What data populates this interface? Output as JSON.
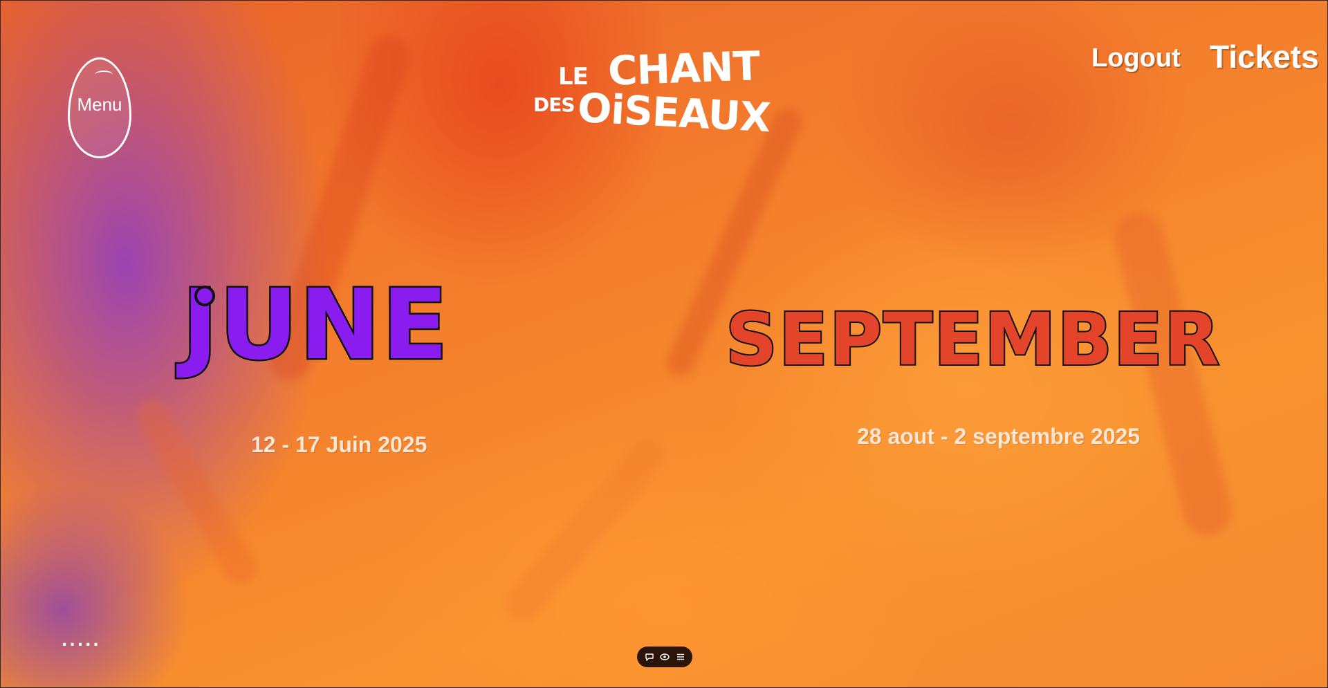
{
  "header": {
    "menu_label": "Menu",
    "logo": {
      "line1_small": "LE",
      "line1_large": "CHANT",
      "line2_small": "DES",
      "line2_large": "OiSEAUX"
    },
    "logout_label": "Logout",
    "tickets_label": "Tickets"
  },
  "editions": [
    {
      "month": "June",
      "dates": "12 - 17 Juin 2025",
      "color": "#8b1cf0"
    },
    {
      "month": "September",
      "dates": "28 aout - 2 septembre 2025",
      "color": "#e4442a"
    }
  ],
  "footer": {
    "dots": ".....",
    "toolbar_icons": [
      "comment-icon",
      "eye-icon",
      "list-icon"
    ]
  },
  "colors": {
    "background_orange": "#f47e2c",
    "background_purple": "#8c3cc8",
    "text_white": "#ffffff"
  }
}
